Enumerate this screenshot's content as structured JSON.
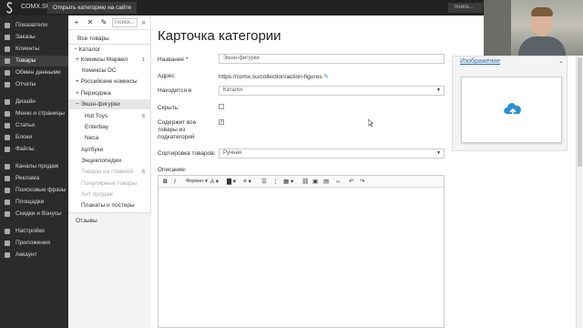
{
  "topbar": {
    "brand": "COMX.SU",
    "open_site": "Открыть категорию на сайте",
    "search": "поиск..."
  },
  "sidebar": {
    "items": [
      {
        "label": "Показатели",
        "icon": "dashboard-icon"
      },
      {
        "label": "Заказы",
        "icon": "orders-icon"
      },
      {
        "label": "Клиенты",
        "icon": "clients-icon"
      },
      {
        "label": "Товары",
        "icon": "products-icon",
        "active": true
      },
      {
        "label": "Обмен данными",
        "icon": "exchange-icon"
      },
      {
        "label": "Отчеты",
        "icon": "reports-icon"
      },
      {
        "label": "Дизайн",
        "icon": "design-icon"
      },
      {
        "label": "Меню и страницы",
        "icon": "menu-icon"
      },
      {
        "label": "Статьи",
        "icon": "articles-icon"
      },
      {
        "label": "Блоки",
        "icon": "blocks-icon"
      },
      {
        "label": "Файлы",
        "icon": "files-icon"
      },
      {
        "label": "Каналы продаж",
        "icon": "channels-icon"
      },
      {
        "label": "Реклама",
        "icon": "ads-icon"
      },
      {
        "label": "Поисковые фразы",
        "icon": "search-phrases-icon"
      },
      {
        "label": "Площадки",
        "icon": "platforms-icon"
      },
      {
        "label": "Скидки и бонусы",
        "icon": "discounts-icon"
      },
      {
        "label": "Настройки",
        "icon": "settings-icon"
      },
      {
        "label": "Приложения",
        "icon": "apps-icon"
      },
      {
        "label": "Аккаунт",
        "icon": "account-icon"
      }
    ]
  },
  "categories": {
    "search_placeholder": "Поиск...",
    "items": [
      {
        "label": "Все товары"
      },
      {
        "label": "Каталог"
      },
      {
        "label": "Комиксы Марвел",
        "count": "1"
      },
      {
        "label": "Комиксы DC"
      },
      {
        "label": "Российские комиксы"
      },
      {
        "label": "Периодика"
      },
      {
        "label": "Экшн-фигурки"
      },
      {
        "label": "Hot Toys",
        "count": "6"
      },
      {
        "label": "Enterbay"
      },
      {
        "label": "Neca"
      },
      {
        "label": "Артбуки"
      },
      {
        "label": "Энциклопедии"
      },
      {
        "label": "Товары на главной",
        "count": "6"
      },
      {
        "label": "Популярные товары"
      },
      {
        "label": "Хит продаж"
      },
      {
        "label": "Плакаты и постеры"
      }
    ],
    "reviews": "Отзывы"
  },
  "form": {
    "title": "Карточка категории",
    "name_label": "Название *",
    "name_value": "Экшн-фигурки",
    "address_label": "Адрес",
    "address_value": "https://comx.su/collection/action-figures",
    "parent_label": "Находится в",
    "parent_value": "Каталог",
    "hide_label": "Скрыть:",
    "contains_label": "Содержит все товары из подкатегорий",
    "sort_label": "Сортировка товаров:",
    "sort_value": "Ручная",
    "description_label": "Описание:",
    "format_label": "Формат"
  },
  "image_panel": {
    "title": "Изображение"
  },
  "colors": {
    "sidebar_bg": "#2b2b2b",
    "topbar_bg": "#222222",
    "accent": "#2a6fb0",
    "upload_icon": "#2f8fd0"
  }
}
